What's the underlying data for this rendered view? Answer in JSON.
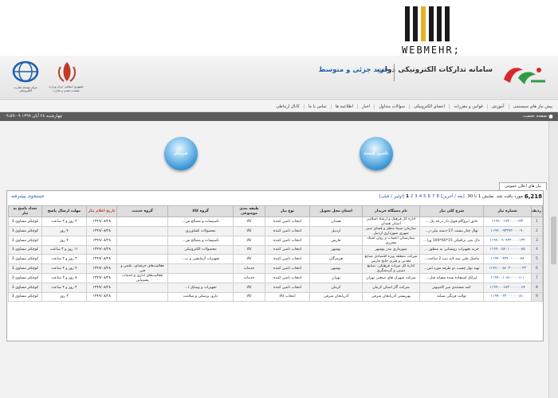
{
  "watermark": {
    "text": "WEBMEHR;"
  },
  "header": {
    "system_title": "سامانه تدارکات الکترونیکی دولت",
    "module_title": "خرید جزئی و متوسط",
    "gov_logo1_caption": "جمهوری اسلامی ایران\nوزارت صنعت، معدن و تجارت",
    "gov_logo2_caption": "مرکز توسعه تجارت الکترونیکی"
  },
  "nav": {
    "items": [
      "پیش نیاز های سیستمی",
      "آموزش",
      "قوانین و مقررات",
      "اعضای الکترونیکی",
      "سوالات متداول",
      "اخبار",
      "اطلاعیه ها",
      "تماس با ما",
      "کانال ارتباطی"
    ]
  },
  "statusbar": {
    "home_label": "صفحه نخست",
    "datetime": "چهارشنبه ۲۸ آبان ۱۳۹۹ ۰۹:۵۹:۰۹"
  },
  "buttons": {
    "buyer": "خریدار",
    "supplier": "تامین کننده"
  },
  "tab_label": "نیاز های اعلان عمومی",
  "pager": {
    "count": "6,218",
    "count_suffix": "مورد",
    "found_text": "یافت شد. نمایش 1 تا 30.",
    "first_last": "[اولین / قبلی]",
    "pages": [
      "1",
      "2",
      "3",
      "4",
      "5",
      "6",
      "7",
      "8"
    ],
    "next_last": "[بعد / آخرین]"
  },
  "advanced_search": "جستجوی پیشرفته",
  "table": {
    "headers": [
      "ردیف",
      "شماره نیاز",
      "شرح کلی نیاز",
      "نام دستگاه خریدار",
      "استان محل تحویل",
      "نوع نیاز",
      "طبقه بندی موضوعی",
      "گروه کالا",
      "گروه خدمت",
      "تاریخ اعلام نیاز",
      "مهلت ارسال پاسخ",
      "تعداد پاسخ به نیاز"
    ],
    "rows": [
      [
        "1",
        "۱۱۹۹۰۰۱۷۳۰۰۰۰۱۳۳",
        "عایق ایزوگام فویل دار درجه یک ...",
        "اداره کل فرهنگ و ارشاد اسلامی استان همدان",
        "همدان",
        "انتخاب تامین کننده",
        "کالا",
        "تاسیسات و مصالح س...",
        "",
        "۱۳۹۹/۰۸/۲۸",
        "۳ روز و ۳ ساعت",
        "کوچکتر مساوی 3"
      ],
      [
        "2",
        "۱۱۹۹۰۰۹۳۳۹۳۰۰۰۰۹۰",
        "نهال چنار بیست 17-دسته بیلی-ر...",
        "سازمان سیما منظر و فضای سبز شهری شهرداری اردبیل",
        "اردبیل",
        "انتخاب تامین کننده",
        "کالا",
        "محصولات کشاورزی",
        "",
        "۱۳۹۹/۰۸/۲۸",
        "۴ روز",
        "کوچکتر مساوی 3"
      ],
      [
        "3",
        "۱۱۹۹۰۰۹۰۹۳۲۰۰۰۰۱۳۳",
        "دال بتنی ترافیکی 15*60*100 ورا...",
        "بیمارستان اعصاب و روان استاد محرری",
        "فارس",
        "انتخاب تامین کننده",
        "کالا",
        "تاسیسات و مصالح س...",
        "",
        "۱۳۹۹/۰۸/۲۸",
        "۴ روز",
        "کوچکتر مساوی 3"
      ],
      [
        "4",
        "۱۱۹۹۰۰۵۷۰۱۰۰۰۰۰۰۸۵",
        "خرید تجهیزات روشنایی به منظور ...",
        "شهرداری بندر بوشهر",
        "بوشهر",
        "انتخاب تامین کننده",
        "کالا",
        "محصولات الکترونیکی",
        "",
        "۱۳۹۹/۰۸/۲۸",
        "۱۱ روز و ۳ ساعت",
        "کوچکتر مساوی 3"
      ],
      [
        "5",
        "۱۱۹۹۰۰۴۳۴۰۰۰۰۰۰۷۸",
        "ماسک طبی سه لایه تیپ 2 ساخت...",
        "شرکت منطقه ویژه اقتصادی صنایع معدنی و فلزی خلیج فارس",
        "هرمزگان",
        "انتخاب تامین کننده",
        "کالا",
        "تجهیزات آزمایشی و پ...",
        "",
        "۱۳۹۹/۰۸/۲۸",
        "۳ روز و ۳ ساعت",
        "کوچکتر مساوی 3"
      ],
      [
        "6",
        "۱۱۹۹۰۰۰۵۶۰۳۰۰۰۰۰۰۳۳",
        "تهیه نوار چسب دو طرفه مورد اس...",
        "اداره کل میراث فرهنگی، صنایع دستی و گردشگری",
        "بوشهر",
        "انتخاب تامین کننده",
        "خدمات",
        "",
        "فعالیت‌های حرفه‌ای، علمی و فنی",
        "۱۳۹۹/۰۸/۲۸",
        "۴ روز و ۳ ساعت",
        "کوچکتر مساوی 3"
      ],
      [
        "7",
        "۱۱۹۹۰۰۱۰۵۱۰۰۰۰۱۱۱",
        "ایرانک استفاده شده مشابه قبل...",
        "شرکت شهرک های صنعتی تهران",
        "تهران",
        "انتخاب تامین کننده",
        "خدمات",
        "",
        "فعالیت‌های اداری و خدمات پشتیبانی",
        "۱۳۹۹/۰۸/۲۸",
        "۸ روز و ۳ ساعت",
        "کوچکتر مساوی 3"
      ],
      [
        "8",
        "۱۱۹۹۰۰۰۶۸۳۰۰۰۰۰۰۶۷",
        "کمد مستندی میز کامپیوتر",
        "شرکت گاز استان کرمان",
        "کرمان",
        "انتخاب تامین کننده",
        "کالا",
        "تجهیزات و وسایل ا...",
        "",
        "۱۳۹۹/۰۸/۲۸",
        "۳ روز و ۳ ساعت",
        "کوچکتر مساوی 3"
      ],
      [
        "9",
        "۱۱۹۹۰۰۲۳۰۰۰۰۰۰۱۸۰",
        "توالت فرنگی صبلنه",
        "بهزیستی آذربایجان شرقی",
        "آذربایجان شرقی",
        "انتخاب کالا",
        "کالا",
        "دارو، پزشکی و سلامت",
        "",
        "۱۳۹۹/۰۸/۲۸",
        "۳ روز",
        "کوچکتر مساوی 3"
      ]
    ]
  }
}
